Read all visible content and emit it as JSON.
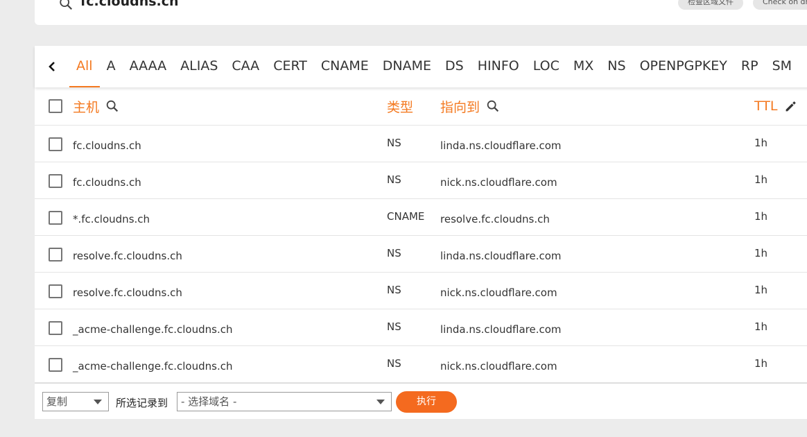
{
  "top": {
    "domain": "fc.cloudns.ch",
    "check_zone_label": "检查区域文件",
    "check_dns_label": "Check on dr"
  },
  "tabs": [
    "All",
    "A",
    "AAAA",
    "ALIAS",
    "CAA",
    "CERT",
    "CNAME",
    "DNAME",
    "DS",
    "HINFO",
    "LOC",
    "MX",
    "NS",
    "OPENPGPKEY",
    "RP",
    "SM"
  ],
  "active_tab": "All",
  "table": {
    "headers": {
      "host": "主机",
      "type": "类型",
      "target": "指向到",
      "ttl": "TTL"
    },
    "rows": [
      {
        "host": "fc.cloudns.ch",
        "type": "NS",
        "target": "linda.ns.cloudflare.com",
        "ttl": "1h"
      },
      {
        "host": "fc.cloudns.ch",
        "type": "NS",
        "target": "nick.ns.cloudflare.com",
        "ttl": "1h"
      },
      {
        "host": "*.fc.cloudns.ch",
        "type": "CNAME",
        "target": "resolve.fc.cloudns.ch",
        "ttl": "1h"
      },
      {
        "host": "resolve.fc.cloudns.ch",
        "type": "NS",
        "target": "linda.ns.cloudflare.com",
        "ttl": "1h"
      },
      {
        "host": "resolve.fc.cloudns.ch",
        "type": "NS",
        "target": "nick.ns.cloudflare.com",
        "ttl": "1h"
      },
      {
        "host": "_acme-challenge.fc.cloudns.ch",
        "type": "NS",
        "target": "linda.ns.cloudflare.com",
        "ttl": "1h"
      },
      {
        "host": "_acme-challenge.fc.cloudns.ch",
        "type": "NS",
        "target": "nick.ns.cloudflare.com",
        "ttl": "1h"
      }
    ]
  },
  "bottom": {
    "action_value": "复制",
    "move_label": "所选记录到",
    "domain_select_value": "- 选择域名 -",
    "execute_label": "执行"
  },
  "colors": {
    "accent": "#f47920",
    "button": "#f46a1f"
  }
}
